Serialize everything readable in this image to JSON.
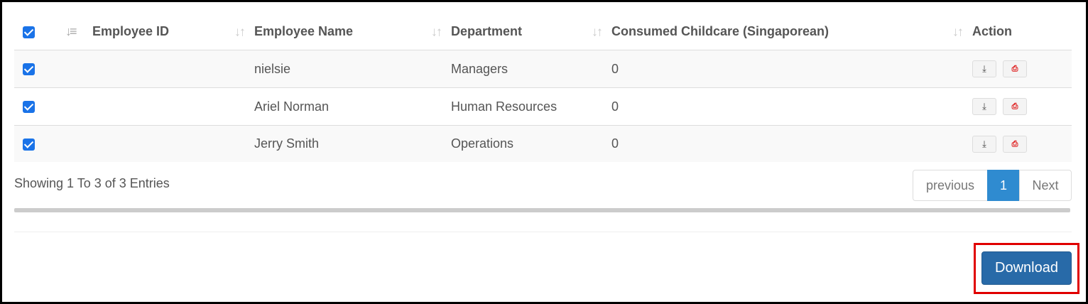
{
  "table": {
    "headers": {
      "employee_id": "Employee ID",
      "employee_name": "Employee Name",
      "department": "Department",
      "consumed": "Consumed Childcare (Singaporean)",
      "action": "Action"
    },
    "rows": [
      {
        "employee_id": "",
        "employee_name": "nielsie",
        "department": "Managers",
        "consumed": "0",
        "checked": true
      },
      {
        "employee_id": "",
        "employee_name": "Ariel Norman",
        "department": "Human Resources",
        "consumed": "0",
        "checked": true
      },
      {
        "employee_id": "",
        "employee_name": "Jerry Smith",
        "department": "Operations",
        "consumed": "0",
        "checked": true
      }
    ]
  },
  "icons": {
    "select_all": "checkbox-checked-icon",
    "sort_first": "sort-amount-icon",
    "sort": "sort-icon",
    "download": "download-icon",
    "pdf": "pdf-file-icon"
  },
  "info": "Showing 1 To 3 of 3 Entries",
  "pagination": {
    "previous": "previous",
    "current": "1",
    "next": "Next"
  },
  "download_button": "Download",
  "colors": {
    "accent": "#2f8bd0",
    "download_button": "#286aa8",
    "highlight_border": "#e00000",
    "pdf_icon": "#dd1111"
  }
}
